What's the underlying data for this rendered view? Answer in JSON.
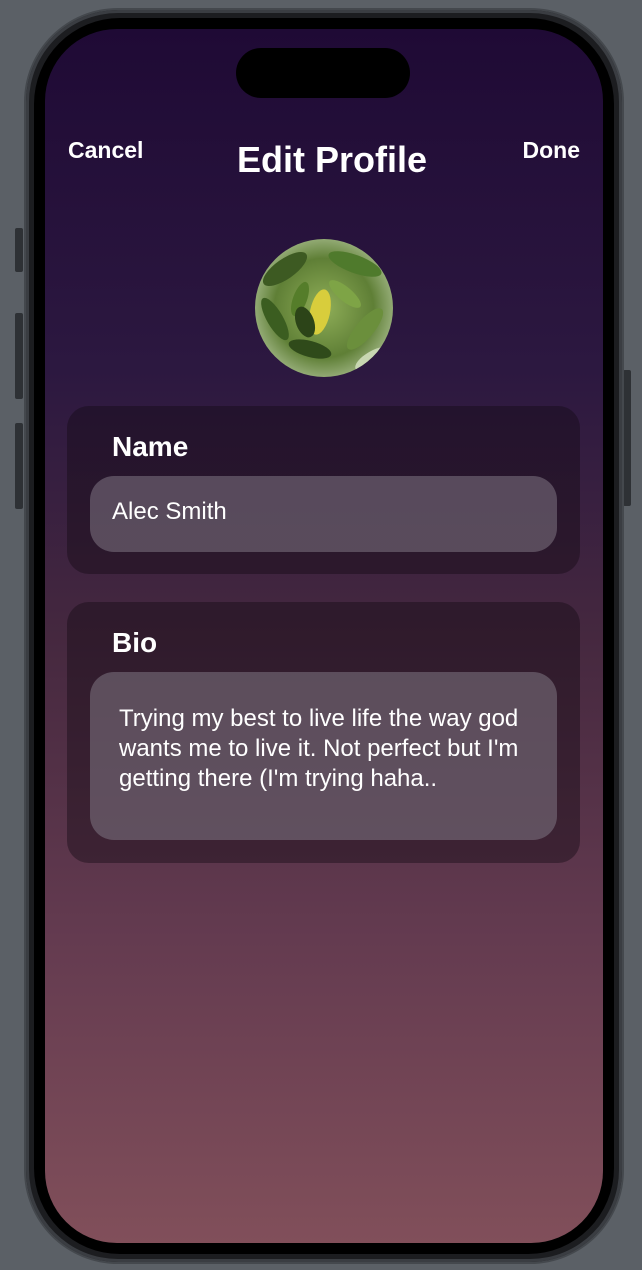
{
  "nav": {
    "cancel_label": "Cancel",
    "title": "Edit Profile",
    "done_label": "Done"
  },
  "profile": {
    "avatar_icon": "profile-photo-leaves"
  },
  "name_section": {
    "label": "Name",
    "value": "Alec Smith"
  },
  "bio_section": {
    "label": "Bio",
    "value": "Trying my best to live life the way god wants me to live it. Not perfect but I'm getting there (I'm trying haha.."
  },
  "colors": {
    "gradient_top": "#1f0a35",
    "gradient_bottom": "#814f5a",
    "text": "#ffffff"
  }
}
